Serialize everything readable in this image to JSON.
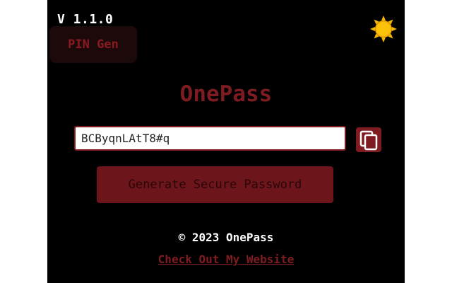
{
  "header": {
    "version": "V 1.1.0",
    "pin_button_label": "PIN Gen",
    "theme_icon": "sun-icon"
  },
  "main": {
    "title": "OnePass",
    "password_value": "BCByqnLAtT8#q",
    "copy_icon": "copy-icon",
    "generate_label": "Generate Secure Password"
  },
  "footer": {
    "copyright": "© 2023 OnePass",
    "link_text": "Check Out My Website"
  },
  "colors": {
    "background": "#000000",
    "accent": "#7e1c22",
    "sun": "#f5b800"
  }
}
